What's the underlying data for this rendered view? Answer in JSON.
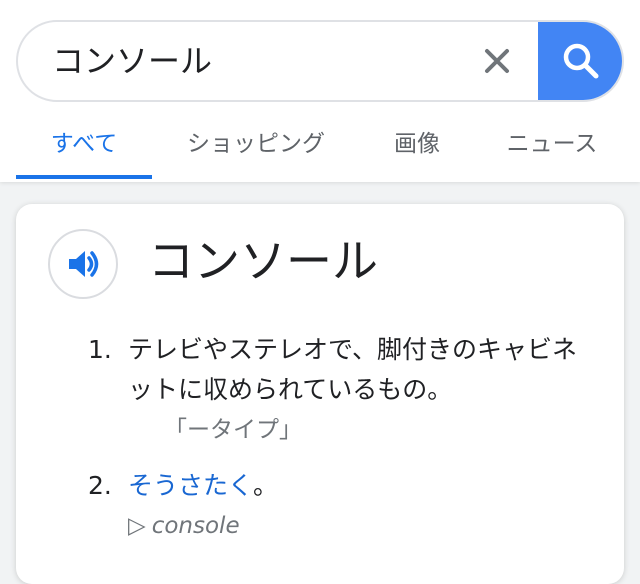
{
  "search": {
    "query": "コンソール"
  },
  "tabs": [
    {
      "label": "すべて",
      "active": true
    },
    {
      "label": "ショッピング",
      "active": false
    },
    {
      "label": "画像",
      "active": false
    },
    {
      "label": "ニュース",
      "active": false
    }
  ],
  "dictionary": {
    "headword": "コンソール",
    "definitions": [
      {
        "number": "1.",
        "text": "テレビやステレオで、脚付きのキャビネットに収められているもの。",
        "example": "「ータイプ」"
      },
      {
        "number": "2.",
        "link": "そうさたく",
        "suffix": "。",
        "origin_marker": "▷",
        "origin": "console"
      }
    ]
  },
  "colors": {
    "accent": "#1a73e8",
    "search_button": "#4285f4"
  }
}
